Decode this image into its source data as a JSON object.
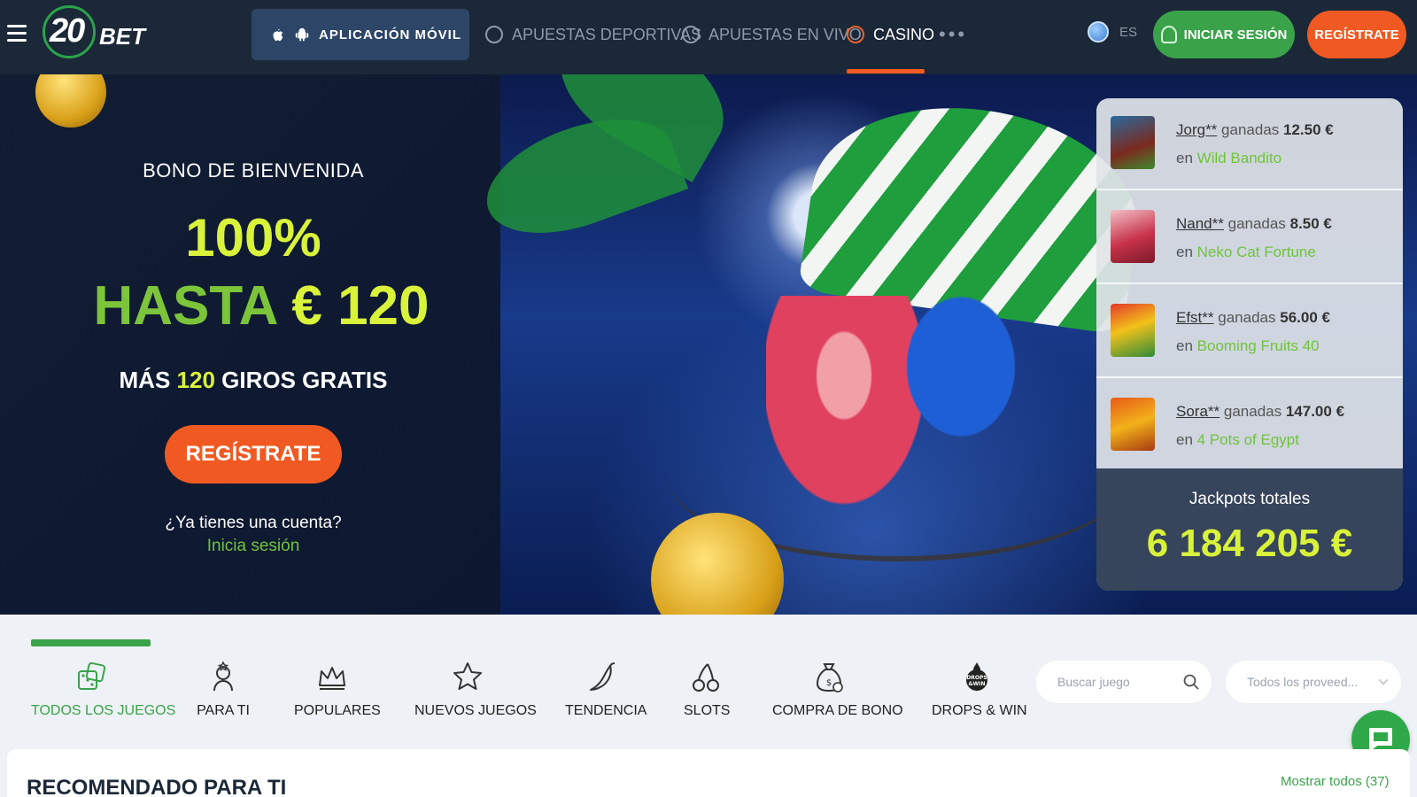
{
  "nav": {
    "logo_text": "20",
    "logo_bet": "BET",
    "app_button": "APLICACIÓN MÓVIL",
    "links": [
      {
        "label": "APUESTAS DEPORTIVAS",
        "icon": "soccer-ball-icon"
      },
      {
        "label": "APUESTAS EN VIVO",
        "icon": "stopwatch-icon"
      },
      {
        "label": "CASINO",
        "icon": "casino-chip-icon",
        "active": true
      }
    ],
    "more": "•••",
    "language": "ES",
    "login": "INICIAR SESIÓN",
    "register": "REGÍSTRATE"
  },
  "hero": {
    "label": "BONO DE BIENVENIDA",
    "percent": "100%",
    "upto_word": "HASTA",
    "upto_amount": "€ 120",
    "spins_prefix": "MÁS",
    "spins_count": "120",
    "spins_suffix": "GIROS GRATIS",
    "register": "REGÍSTRATE",
    "have_account": "¿Ya tienes una cuenta?",
    "login_link": "Inicia sesión"
  },
  "winners": [
    {
      "user": "Jorg**",
      "won": "ganadas",
      "amount": "12.50 €",
      "in": "en",
      "game": "Wild Bandito",
      "thumb_color": "#7a2a1e"
    },
    {
      "user": "Nand**",
      "won": "ganadas",
      "amount": "8.50 €",
      "in": "en",
      "game": "Neko Cat Fortune",
      "thumb_color": "#c8324a"
    },
    {
      "user": "Efst**",
      "won": "ganadas",
      "amount": "56.00 €",
      "in": "en",
      "game": "Booming Fruits 40",
      "thumb_color": "#2e8b3a"
    },
    {
      "user": "Sora**",
      "won": "ganadas",
      "amount": "147.00 €",
      "in": "en",
      "game": "4 Pots of Egypt",
      "thumb_color": "#d9861a"
    }
  ],
  "jackpot": {
    "title": "Jackpots totales",
    "value": "6 184 205 €"
  },
  "categories": [
    {
      "label": "TODOS LOS JUEGOS",
      "icon": "dice-icon",
      "active": true
    },
    {
      "label": "PARA TI",
      "icon": "person-star-icon"
    },
    {
      "label": "POPULARES",
      "icon": "crown-icon"
    },
    {
      "label": "NUEVOS JUEGOS",
      "icon": "star-icon"
    },
    {
      "label": "TENDENCIA",
      "icon": "chili-pepper-icon"
    },
    {
      "label": "SLOTS",
      "icon": "cherries-icon"
    },
    {
      "label": "COMPRA DE BONO",
      "icon": "money-bag-icon"
    },
    {
      "label": "DROPS & WIN",
      "icon": "drops-win-icon"
    }
  ],
  "search": {
    "placeholder": "Buscar juego"
  },
  "provider": {
    "value": "Todos los proveed..."
  },
  "recommended": {
    "title": "RECOMENDADO PARA TI",
    "show_all": "Mostrar todos  (37)"
  },
  "colors": {
    "nav_bg": "#1b2838",
    "accent_orange": "#f05a22",
    "accent_green": "#3aa34a",
    "highlight_yellow": "#d9f23a"
  }
}
